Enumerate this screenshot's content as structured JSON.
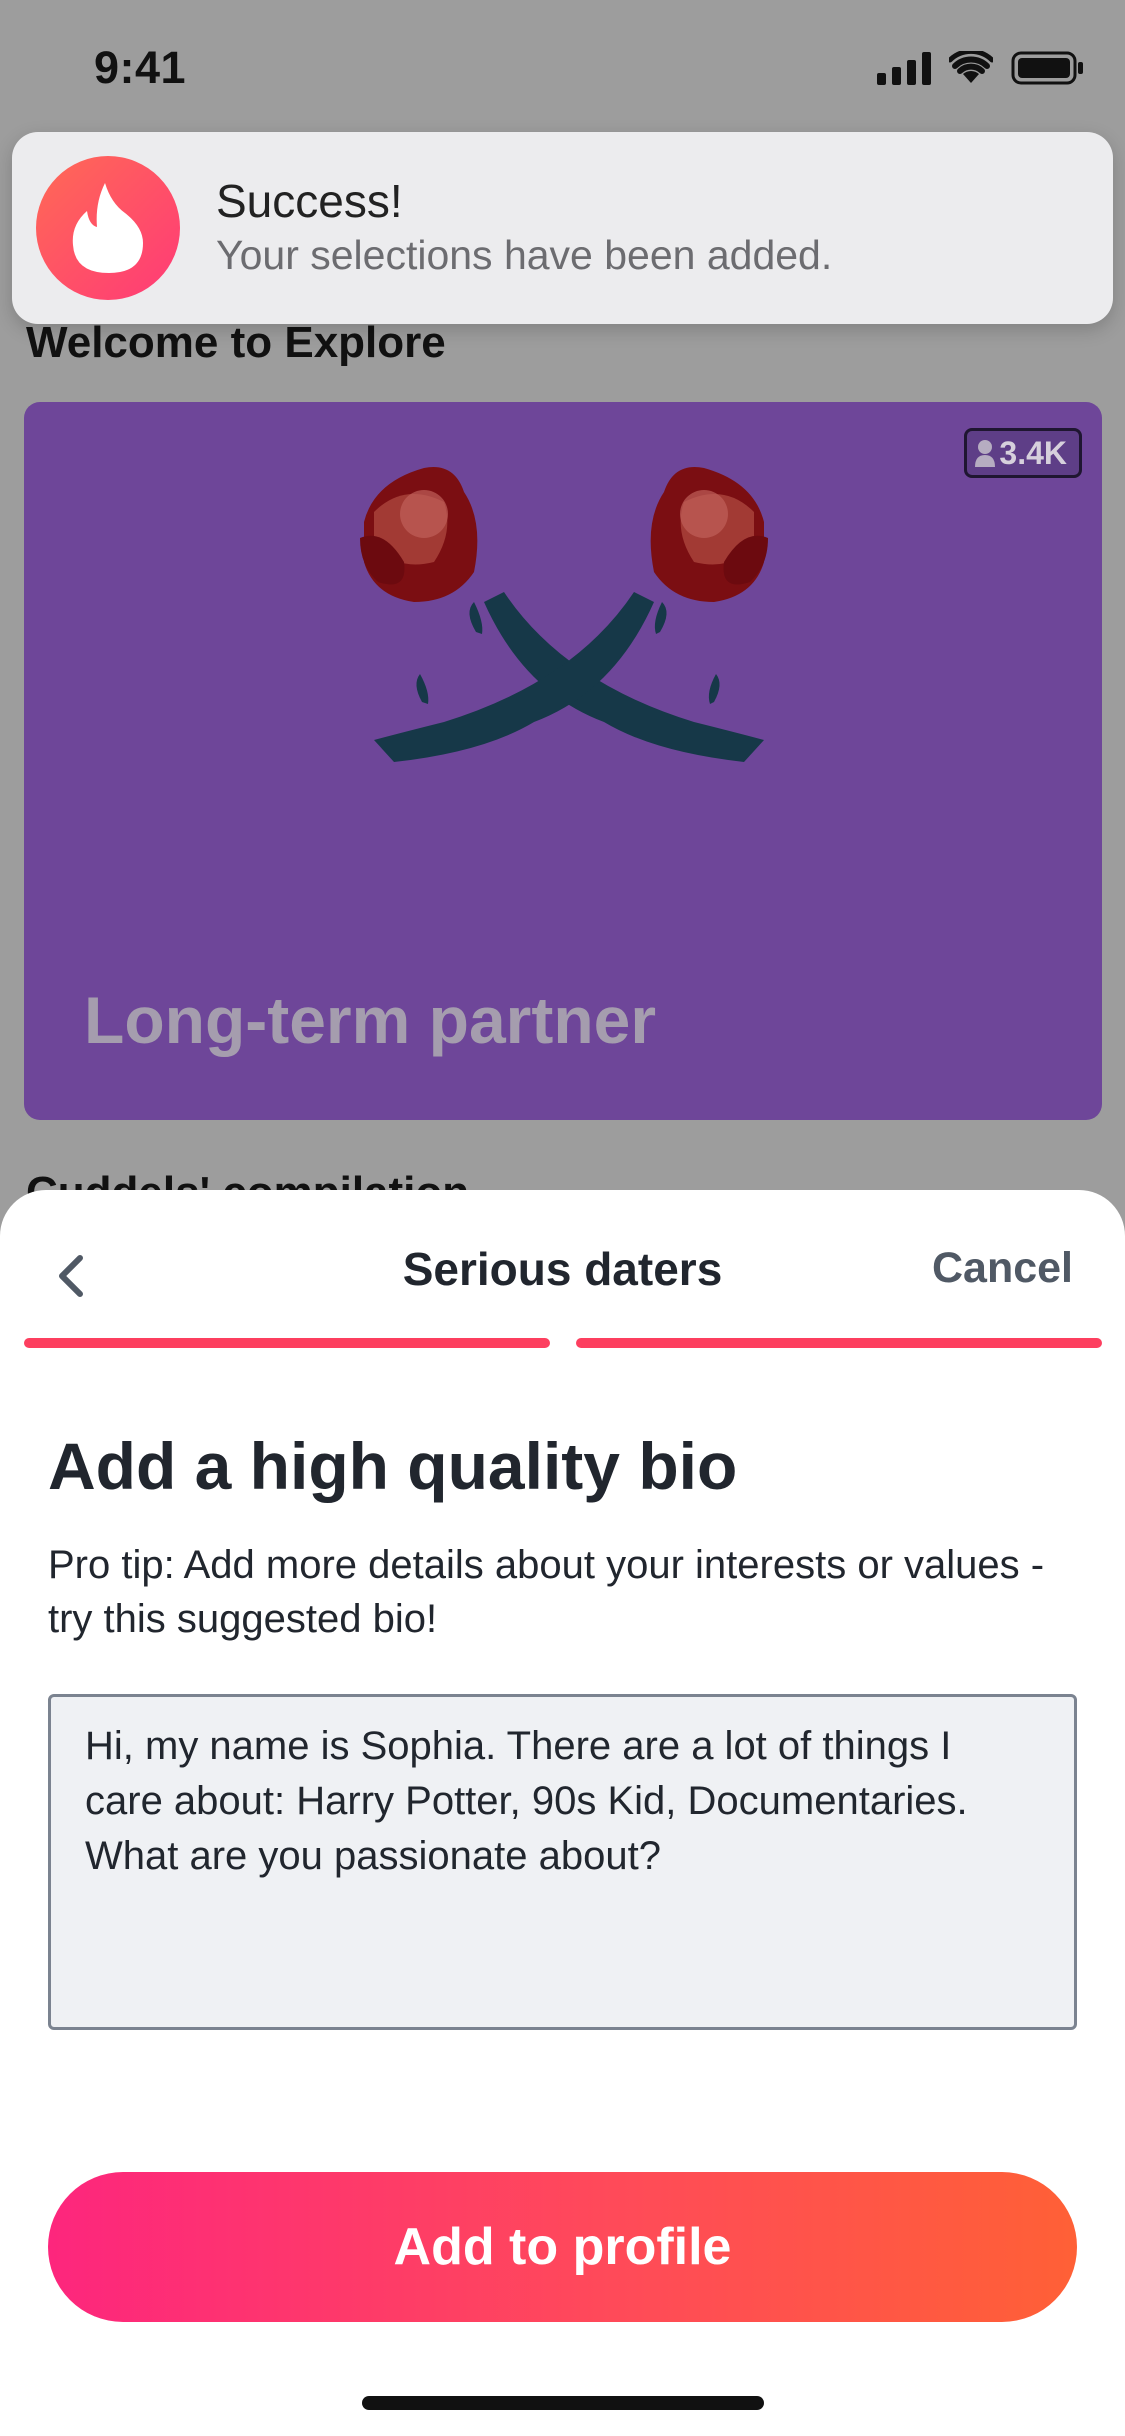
{
  "status_bar": {
    "time": "9:41"
  },
  "notification": {
    "title": "Success!",
    "message": "Your selections have been added.",
    "icon": "tinder-flame-icon"
  },
  "explore": {
    "welcome_title": "Welcome to Explore",
    "card": {
      "count": "3.4K",
      "title": "Long-term partner",
      "background_color": "#6e4699"
    },
    "next_section_peek": "Cuddels' compilation"
  },
  "sheet": {
    "title": "Serious daters",
    "cancel_label": "Cancel",
    "progress_steps_completed": 2,
    "progress_steps_total": 2,
    "heading": "Add a high quality bio",
    "tip": "Pro tip: Add more details about your interests or values - try this suggested bio!",
    "bio_value": "Hi, my name is Sophia. There are a lot of things I care about: Harry Potter, 90s Kid, Documentaries. What are you passionate about?",
    "add_button_label": "Add to profile"
  },
  "colors": {
    "accent": "#fd3f5f",
    "button_gradient_start": "#fd267d",
    "button_gradient_end": "#ff6036",
    "text_dark": "#21262e"
  }
}
